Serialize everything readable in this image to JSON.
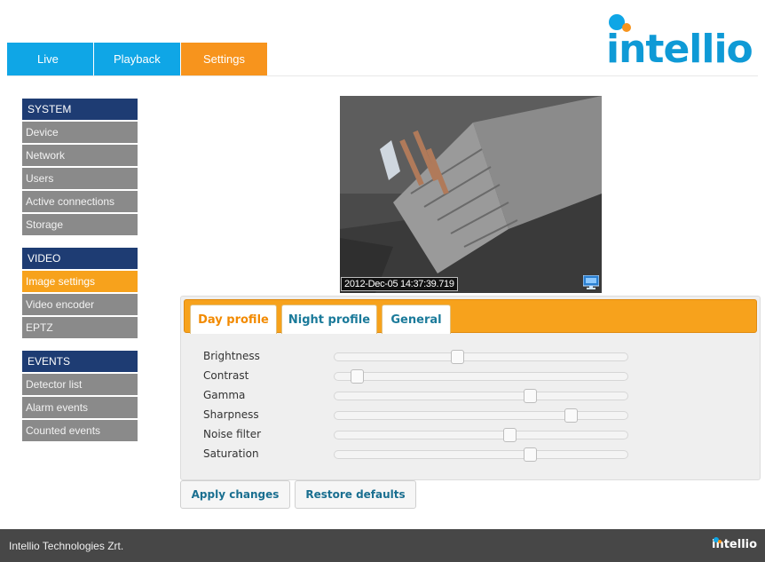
{
  "nav": {
    "tabs": [
      {
        "label": "Live"
      },
      {
        "label": "Playback"
      },
      {
        "label": "Settings"
      }
    ],
    "active": "Settings"
  },
  "brand": {
    "logo_text": "intellio",
    "colors": {
      "blue": "#0fa6e6",
      "orange": "#f7941d",
      "navy": "#1e3c73"
    }
  },
  "sidebar": {
    "sections": [
      {
        "header": "SYSTEM",
        "items": [
          "Device",
          "Network",
          "Users",
          "Active connections",
          "Storage"
        ]
      },
      {
        "header": "VIDEO",
        "items": [
          "Image settings",
          "Video encoder",
          "EPTZ"
        ]
      },
      {
        "header": "EVENTS",
        "items": [
          "Detector list",
          "Alarm events",
          "Counted events"
        ]
      }
    ],
    "active_item": "Image settings"
  },
  "video": {
    "timestamp": "2012-Dec-05 14:37:39.719",
    "overlay_icon": "monitor-icon"
  },
  "profile_tabs": [
    {
      "label": "Day profile",
      "active": true
    },
    {
      "label": "Night profile",
      "active": false
    },
    {
      "label": "General",
      "active": false
    }
  ],
  "sliders": [
    {
      "label": "Brightness",
      "value": 0.42
    },
    {
      "label": "Contrast",
      "value": 0.08
    },
    {
      "label": "Gamma",
      "value": 0.67
    },
    {
      "label": "Sharpness",
      "value": 0.81
    },
    {
      "label": "Noise filter",
      "value": 0.6
    },
    {
      "label": "Saturation",
      "value": 0.67
    }
  ],
  "buttons": {
    "apply_label": "Apply changes",
    "restore_label": "Restore defaults"
  },
  "footer": {
    "company": "Intellio Technologies Zrt.",
    "logo_text": "intellio"
  }
}
